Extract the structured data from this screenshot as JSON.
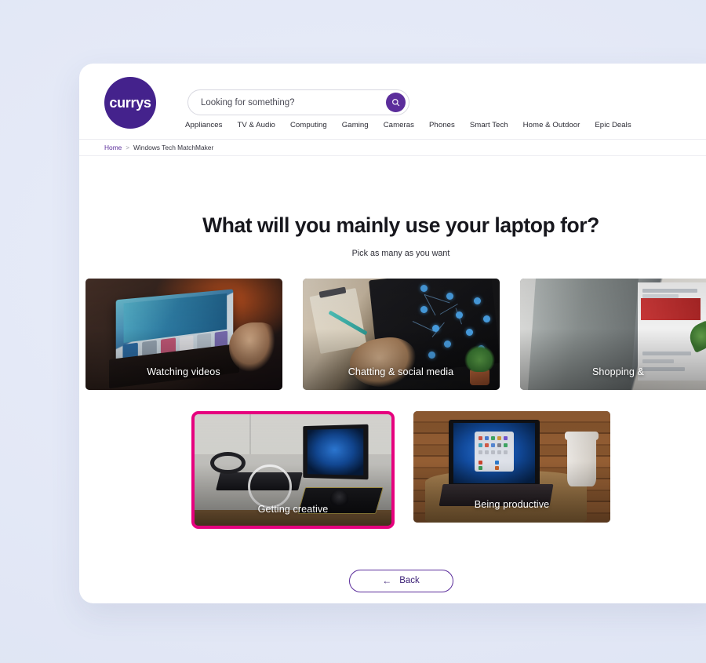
{
  "brand": {
    "logo_text": "currys",
    "purple": "#44228c",
    "accent_purple": "#5b2d9b",
    "selection_pink": "#e6007e",
    "page_background": "#e6eaf8"
  },
  "search": {
    "placeholder": "Looking for something?",
    "value": "",
    "icon": "search-icon"
  },
  "nav": {
    "items": [
      {
        "label": "Appliances"
      },
      {
        "label": "TV & Audio"
      },
      {
        "label": "Computing"
      },
      {
        "label": "Gaming"
      },
      {
        "label": "Cameras"
      },
      {
        "label": "Phones"
      },
      {
        "label": "Smart Tech"
      },
      {
        "label": "Home & Outdoor"
      },
      {
        "label": "Epic Deals"
      }
    ]
  },
  "breadcrumb": {
    "home": "Home",
    "separator": ">",
    "current": "Windows Tech MatchMaker"
  },
  "quiz": {
    "title": "What will you mainly use your laptop for?",
    "subtitle": "Pick as many as you want",
    "options_row1": [
      {
        "label": "Watching videos",
        "selected": false,
        "image": "laptop-streaming-video"
      },
      {
        "label": "Chatting & social media",
        "selected": false,
        "image": "hands-typing-laptop-network-nodes"
      },
      {
        "label": "Shopping &",
        "selected": false,
        "image": "laptop-lid-shopping-page",
        "clipped": true
      }
    ],
    "options_row2": [
      {
        "label": "Getting creative",
        "selected": true,
        "image": "desk-laptop-keyboard-headphones"
      },
      {
        "label": "Being productive",
        "selected": false,
        "image": "laptop-windows11-coffee-cup"
      }
    ]
  },
  "footer": {
    "back_label": "Back",
    "back_arrow": "←"
  }
}
